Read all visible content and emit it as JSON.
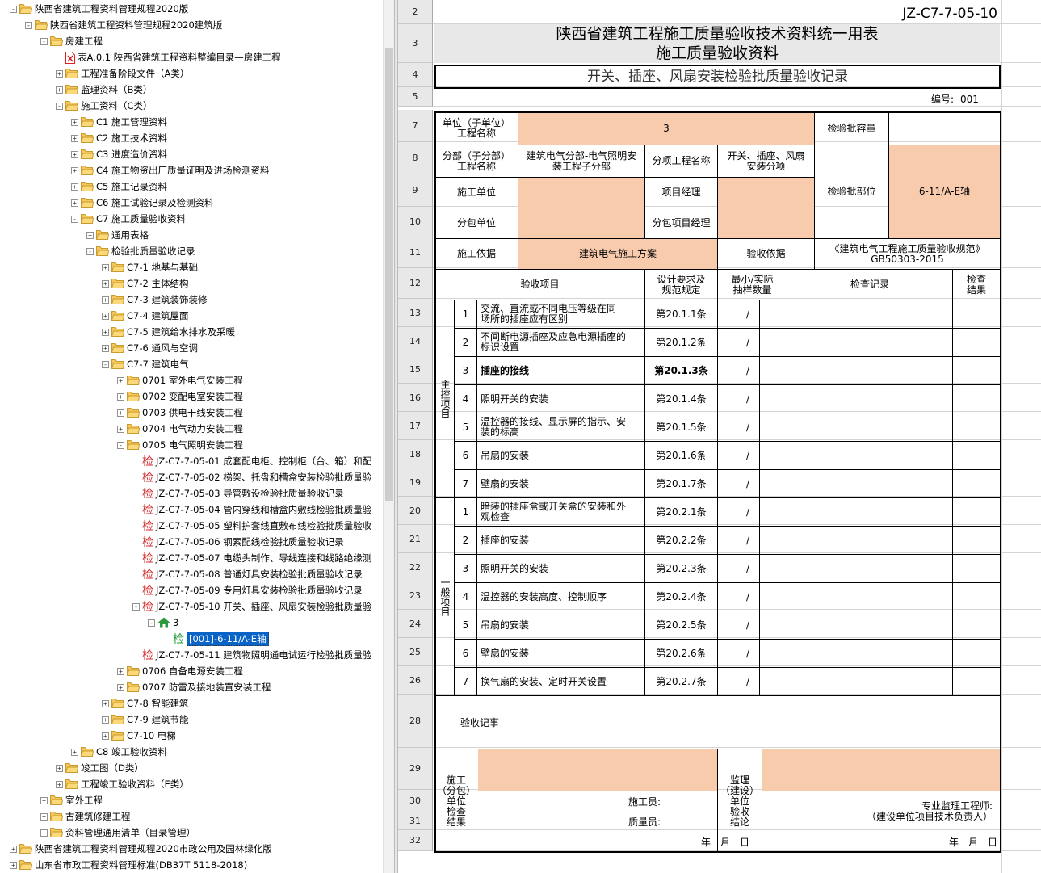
{
  "tree": [
    {
      "level": 0,
      "exp": "-",
      "icon": "folder",
      "label": "陕西省建筑工程资料管理规程2020版"
    },
    {
      "level": 1,
      "exp": "-",
      "icon": "folder",
      "label": "陕西省建筑工程资料管理规程2020建筑版"
    },
    {
      "level": 2,
      "exp": "-",
      "icon": "folder",
      "label": "房建工程"
    },
    {
      "level": 3,
      "exp": "",
      "icon": "pdf",
      "label": "表A.0.1 陕西省建筑工程资料整编目录—房建工程"
    },
    {
      "level": 3,
      "exp": "+",
      "icon": "folder",
      "label": "工程准备阶段文件（A类）"
    },
    {
      "level": 3,
      "exp": "+",
      "icon": "folder",
      "label": "监理资料（B类）"
    },
    {
      "level": 3,
      "exp": "-",
      "icon": "folder",
      "label": "施工资料（C类）"
    },
    {
      "level": 4,
      "exp": "+",
      "icon": "folder",
      "label": "C1 施工管理资料"
    },
    {
      "level": 4,
      "exp": "+",
      "icon": "folder",
      "label": "C2 施工技术资料"
    },
    {
      "level": 4,
      "exp": "+",
      "icon": "folder",
      "label": "C3 进度造价资料"
    },
    {
      "level": 4,
      "exp": "+",
      "icon": "folder",
      "label": "C4 施工物资出厂质量证明及进场检测资料"
    },
    {
      "level": 4,
      "exp": "+",
      "icon": "folder",
      "label": "C5 施工记录资料"
    },
    {
      "level": 4,
      "exp": "+",
      "icon": "folder",
      "label": "C6 施工试验记录及检测资料"
    },
    {
      "level": 4,
      "exp": "-",
      "icon": "folder",
      "label": "C7 施工质量验收资料"
    },
    {
      "level": 5,
      "exp": "+",
      "icon": "folder",
      "label": "通用表格"
    },
    {
      "level": 5,
      "exp": "-",
      "icon": "folder",
      "label": "检验批质量验收记录"
    },
    {
      "level": 6,
      "exp": "+",
      "icon": "folder",
      "label": "C7-1 地基与基础"
    },
    {
      "level": 6,
      "exp": "+",
      "icon": "folder",
      "label": "C7-2 主体结构"
    },
    {
      "level": 6,
      "exp": "+",
      "icon": "folder",
      "label": "C7-3 建筑装饰装修"
    },
    {
      "level": 6,
      "exp": "+",
      "icon": "folder",
      "label": "C7-4 建筑屋面"
    },
    {
      "level": 6,
      "exp": "+",
      "icon": "folder",
      "label": "C7-5 建筑给水排水及采暖"
    },
    {
      "level": 6,
      "exp": "+",
      "icon": "folder",
      "label": "C7-6 通风与空调"
    },
    {
      "level": 6,
      "exp": "-",
      "icon": "folder",
      "label": "C7-7 建筑电气"
    },
    {
      "level": 7,
      "exp": "+",
      "icon": "folder",
      "label": "0701 室外电气安装工程"
    },
    {
      "level": 7,
      "exp": "+",
      "icon": "folder",
      "label": "0702 变配电室安装工程"
    },
    {
      "level": 7,
      "exp": "+",
      "icon": "folder",
      "label": "0703 供电干线安装工程"
    },
    {
      "level": 7,
      "exp": "+",
      "icon": "folder",
      "label": "0704 电气动力安装工程"
    },
    {
      "level": 7,
      "exp": "-",
      "icon": "folder",
      "label": "0705 电气照明安装工程"
    },
    {
      "level": 8,
      "exp": "",
      "icon": "jian",
      "label": "JZ-C7-7-05-01 成套配电柜、控制柜（台、箱）和配"
    },
    {
      "level": 8,
      "exp": "",
      "icon": "jian",
      "label": "JZ-C7-7-05-02 梯架、托盘和槽盒安装检验批质量验"
    },
    {
      "level": 8,
      "exp": "",
      "icon": "jian",
      "label": "JZ-C7-7-05-03 导管敷设检验批质量验收记录"
    },
    {
      "level": 8,
      "exp": "",
      "icon": "jian",
      "label": "JZ-C7-7-05-04 管内穿线和槽盒内敷线检验批质量验"
    },
    {
      "level": 8,
      "exp": "",
      "icon": "jian",
      "label": "JZ-C7-7-05-05 塑料护套线直敷布线检验批质量验收"
    },
    {
      "level": 8,
      "exp": "",
      "icon": "jian",
      "label": "JZ-C7-7-05-06 钢索配线检验批质量验收记录"
    },
    {
      "level": 8,
      "exp": "",
      "icon": "jian",
      "label": "JZ-C7-7-05-07 电缆头制作、导线连接和线路绝缘测"
    },
    {
      "level": 8,
      "exp": "",
      "icon": "jian",
      "label": "JZ-C7-7-05-08 普通灯具安装检验批质量验收记录"
    },
    {
      "level": 8,
      "exp": "",
      "icon": "jian",
      "label": "JZ-C7-7-05-09 专用灯具安装检验批质量验收记录"
    },
    {
      "level": 8,
      "exp": "-",
      "icon": "jian",
      "label": "JZ-C7-7-05-10 开关、插座、风扇安装检验批质量验"
    },
    {
      "level": 9,
      "exp": "-",
      "icon": "home",
      "label": "3"
    },
    {
      "level": 10,
      "exp": "",
      "icon": "jiangreen",
      "label": "[001]-6-11/A-E轴",
      "selected": true
    },
    {
      "level": 8,
      "exp": "",
      "icon": "jian",
      "label": "JZ-C7-7-05-11 建筑物照明通电试运行检验批质量验"
    },
    {
      "level": 7,
      "exp": "+",
      "icon": "folder",
      "label": "0706 自备电源安装工程"
    },
    {
      "level": 7,
      "exp": "+",
      "icon": "folder",
      "label": "0707 防雷及接地装置安装工程"
    },
    {
      "level": 6,
      "exp": "+",
      "icon": "folder",
      "label": "C7-8 智能建筑"
    },
    {
      "level": 6,
      "exp": "+",
      "icon": "folder",
      "label": "C7-9 建筑节能"
    },
    {
      "level": 6,
      "exp": "+",
      "icon": "folder",
      "label": "C7-10 电梯"
    },
    {
      "level": 4,
      "exp": "+",
      "icon": "folder",
      "label": "C8 竣工验收资料"
    },
    {
      "level": 3,
      "exp": "+",
      "icon": "folder",
      "label": "竣工图（D类）"
    },
    {
      "level": 3,
      "exp": "+",
      "icon": "folder",
      "label": "工程竣工验收资料（E类）"
    },
    {
      "level": 2,
      "exp": "+",
      "icon": "folder",
      "label": "室外工程"
    },
    {
      "level": 2,
      "exp": "+",
      "icon": "folder",
      "label": "古建筑修建工程"
    },
    {
      "level": 2,
      "exp": "+",
      "icon": "folder",
      "label": "资料管理通用清单（目录管理）"
    },
    {
      "level": 0,
      "exp": "+",
      "icon": "folder",
      "label": "陕西省建筑工程资料管理规程2020市政公用及园林绿化版"
    },
    {
      "level": 0,
      "exp": "+",
      "icon": "folder",
      "label": "山东省市政工程资料管理标准(DB37T 5118-2018)"
    }
  ],
  "sheet": {
    "row_numbers": [
      "2",
      "3",
      "4",
      "5",
      "7",
      "8",
      "9",
      "10",
      "11",
      "12",
      "13",
      "14",
      "15",
      "16",
      "17",
      "18",
      "19",
      "20",
      "21",
      "22",
      "23",
      "24",
      "25",
      "26",
      "28",
      "29",
      "30",
      "31",
      "32"
    ],
    "code": "JZ-C7-7-05-10",
    "title1": "陕西省建筑工程施工质量验收技术资料统一用表",
    "title2": "施工质量验收资料",
    "subtitle": "开关、插座、风扇安装检验批质量验收记录",
    "number_label": "编号:",
    "number_value": "001",
    "unit_label": "单位（子单位）\n工程名称",
    "unit_value": "3",
    "capacity_label": "检验批容量",
    "division_label": "分部（子分部）\n工程名称",
    "division_value": "建筑电气分部-电气照明安\n装工程子分部",
    "subitem_label": "分项工程名称",
    "subitem_value": "开关、插座、风扇\n安装分项",
    "part_label": "检验批部位",
    "part_value": "6-11/A-E轴",
    "contractor_label": "施工单位",
    "pm_label": "项目经理",
    "sub_label": "分包单位",
    "sub_pm_label": "分包项目经理",
    "basis_label": "施工依据",
    "basis_value": "建筑电气施工方案",
    "accept_basis_label": "验收依据",
    "accept_basis_value": "《建筑电气工程施工质量验收规范》\nGB50303-2015",
    "h_item": "验收项目",
    "h_design": "设计要求及\n规范规定",
    "h_sample": "最小/实际\n抽样数量",
    "h_record": "检查记录",
    "h_result": "检查\n结果",
    "main_group": "主控项目",
    "general_group": "一般项目",
    "main_items": [
      {
        "n": "1",
        "text": "交流、直流或不同电压等级在同一\n场所的插座应有区别",
        "clause": "第20.1.1条",
        "slash": "/"
      },
      {
        "n": "2",
        "text": "不间断电源插座及应急电源插座的\n标识设置",
        "clause": "第20.1.2条",
        "slash": "/"
      },
      {
        "n": "3",
        "text": "插座的接线",
        "clause": "第20.1.3条",
        "slash": "/",
        "bold": true
      },
      {
        "n": "4",
        "text": "照明开关的安装",
        "clause": "第20.1.4条",
        "slash": "/"
      },
      {
        "n": "5",
        "text": "温控器的接线、显示屏的指示、安\n装的标高",
        "clause": "第20.1.5条",
        "slash": "/"
      },
      {
        "n": "6",
        "text": "吊扇的安装",
        "clause": "第20.1.6条",
        "slash": "/"
      },
      {
        "n": "7",
        "text": "壁扇的安装",
        "clause": "第20.1.7条",
        "slash": "/"
      }
    ],
    "general_items": [
      {
        "n": "1",
        "text": "暗装的插座盒或开关盒的安装和外\n观检查",
        "clause": "第20.2.1条",
        "slash": "/"
      },
      {
        "n": "2",
        "text": "插座的安装",
        "clause": "第20.2.2条",
        "slash": "/"
      },
      {
        "n": "3",
        "text": "照明开关的安装",
        "clause": "第20.2.3条",
        "slash": "/"
      },
      {
        "n": "4",
        "text": "温控器的安装高度、控制顺序",
        "clause": "第20.2.4条",
        "slash": "/"
      },
      {
        "n": "5",
        "text": "吊扇的安装",
        "clause": "第20.2.5条",
        "slash": "/"
      },
      {
        "n": "6",
        "text": "壁扇的安装",
        "clause": "第20.2.6条",
        "slash": "/"
      },
      {
        "n": "7",
        "text": "换气扇的安装、定时开关设置",
        "clause": "第20.2.7条",
        "slash": "/"
      }
    ],
    "notes_label": "验收记事",
    "contractor_result": "施工\n（分包）\n单位\n检查\n结果",
    "builder_label": "施工员:",
    "quality_label": "质量员:",
    "date_left": "年　月　日",
    "supervisor_result": "监理\n（建设）\n单位\n验收\n结论",
    "engineer_label": "专业监理工程师:\n（建设单位项目技术负责人）",
    "date_right": "年　月　日"
  }
}
